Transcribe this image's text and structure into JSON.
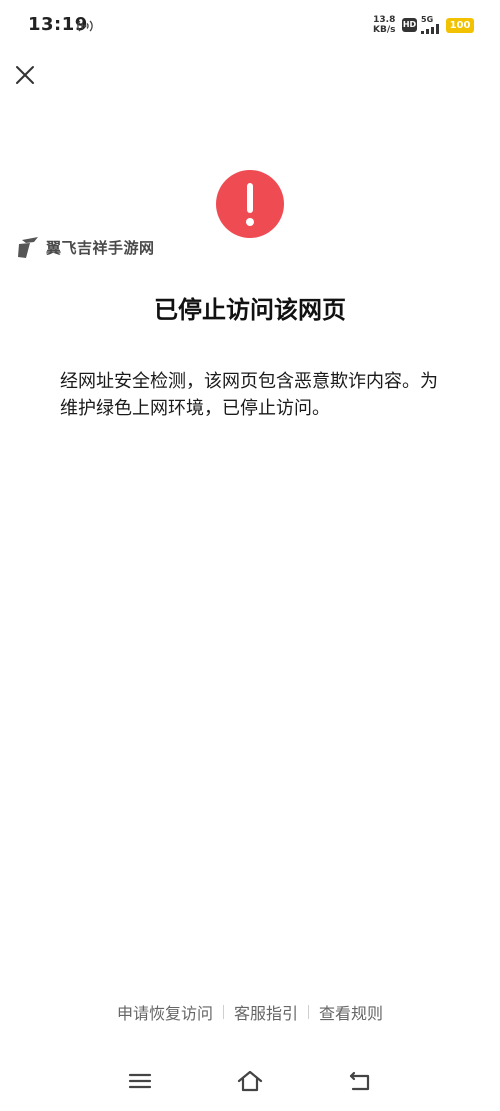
{
  "status_bar": {
    "time": "13:19",
    "speed_value": "13.8",
    "speed_unit": "KB/s",
    "hd_label": "HD",
    "network_type": "5G",
    "battery": "100",
    "battery_color": "#f2c200",
    "hotspot_icon": "hotspot-icon",
    "signal_icon": "signal-bars-icon"
  },
  "close_icon": "close-icon",
  "warning_icon": {
    "name": "exclamation-circle-icon",
    "color": "#ef4b53"
  },
  "watermark": {
    "text": "翼飞吉祥手游网"
  },
  "page_title": "已停止访问该网页",
  "description": "经网址安全检测，该网页包含恶意欺诈内容。为维护绿色上网环境，已停止访问。",
  "footer_links": [
    {
      "label": "申请恢复访问"
    },
    {
      "label": "客服指引"
    },
    {
      "label": "查看规则"
    }
  ],
  "nav_bar": {
    "menu_icon": "menu-icon",
    "home_icon": "home-icon",
    "back_icon": "back-icon"
  }
}
